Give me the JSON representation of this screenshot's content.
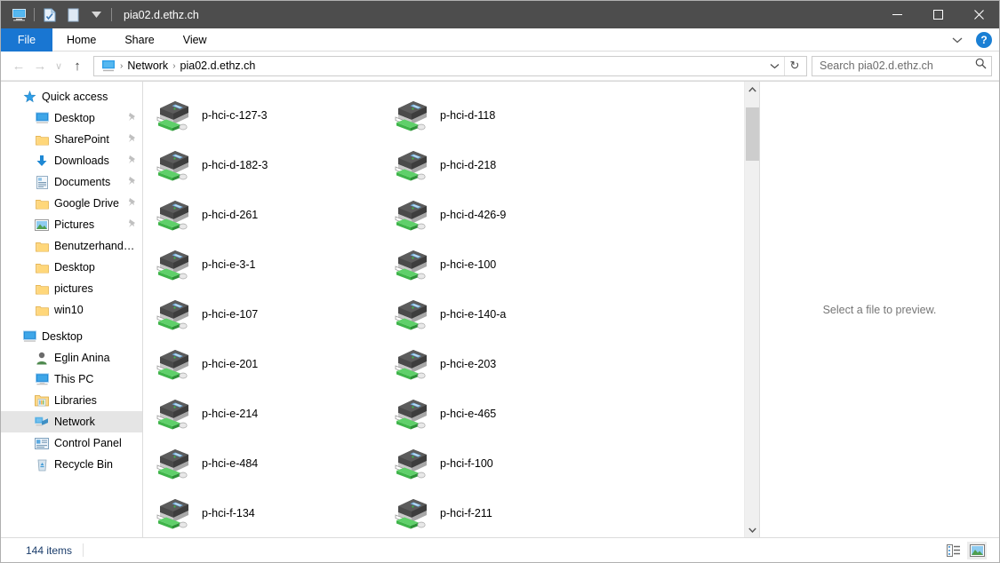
{
  "window": {
    "title": "pia02.d.ethz.ch",
    "quick_access_toolbar": [
      {
        "name": "this-pc-icon",
        "label": "This PC"
      },
      {
        "name": "properties-icon",
        "label": "Properties"
      },
      {
        "name": "new-folder-icon",
        "label": "New folder"
      },
      {
        "name": "customize-qat-dropdown",
        "label": "Customize Quick Access Toolbar"
      }
    ],
    "controls": {
      "minimize": "–",
      "maximize": "□",
      "close": "✕"
    }
  },
  "ribbon": {
    "tabs": [
      {
        "label": "File",
        "active": true
      },
      {
        "label": "Home",
        "active": false
      },
      {
        "label": "Share",
        "active": false
      },
      {
        "label": "View",
        "active": false
      }
    ],
    "collapse_label": "∨",
    "help_label": "?"
  },
  "addressbar": {
    "back_label": "←",
    "forward_label": "→",
    "recent_label": "∨",
    "up_label": "↑",
    "breadcrumbs": [
      "Network",
      "pia02.d.ethz.ch"
    ],
    "separator": "›",
    "dropdown_label": "∨",
    "refresh_label": "↻"
  },
  "search": {
    "placeholder": "Search pia02.d.ethz.ch",
    "value": "",
    "icon": "search-icon"
  },
  "sidebar": {
    "groups": [
      {
        "name": "quick-access",
        "header": {
          "label": "Quick access",
          "icon": "star-pin-icon",
          "level": 0
        },
        "items": [
          {
            "label": "Desktop",
            "icon": "desktop-icon",
            "pinned": true
          },
          {
            "label": "SharePoint",
            "icon": "folder-icon",
            "pinned": true
          },
          {
            "label": "Downloads",
            "icon": "download-icon",
            "pinned": true
          },
          {
            "label": "Documents",
            "icon": "documents-icon",
            "pinned": true
          },
          {
            "label": "Google Drive",
            "icon": "folder-icon",
            "pinned": true
          },
          {
            "label": "Pictures",
            "icon": "pictures-icon",
            "pinned": true
          },
          {
            "label": "Benutzerhandbuch",
            "icon": "folder-icon",
            "pinned": false
          },
          {
            "label": "Desktop",
            "icon": "folder-icon",
            "pinned": false
          },
          {
            "label": "pictures",
            "icon": "folder-icon",
            "pinned": false
          },
          {
            "label": "win10",
            "icon": "folder-icon",
            "pinned": false
          }
        ]
      },
      {
        "name": "tree-roots",
        "header": null,
        "items": [
          {
            "label": "Desktop",
            "icon": "desktop-icon",
            "pinned": false,
            "level": 0
          },
          {
            "label": "Eglin  Anina",
            "icon": "user-icon",
            "pinned": false,
            "level": 0
          },
          {
            "label": "This PC",
            "icon": "this-pc-icon",
            "pinned": false,
            "level": 0
          },
          {
            "label": "Libraries",
            "icon": "libraries-icon",
            "pinned": false,
            "level": 0
          },
          {
            "label": "Network",
            "icon": "network-icon",
            "pinned": false,
            "level": 0,
            "selected": true
          },
          {
            "label": "Control Panel",
            "icon": "control-panel-icon",
            "pinned": false,
            "level": 0
          },
          {
            "label": "Recycle Bin",
            "icon": "recycle-bin-icon",
            "pinned": false,
            "level": 0
          }
        ]
      }
    ]
  },
  "files": {
    "icon": "printer-icon",
    "columns": 2,
    "rows": [
      [
        "p-hci-c-127-3",
        "p-hci-d-118"
      ],
      [
        "p-hci-d-182-3",
        "p-hci-d-218"
      ],
      [
        "p-hci-d-261",
        "p-hci-d-426-9"
      ],
      [
        "p-hci-e-3-1",
        "p-hci-e-100"
      ],
      [
        "p-hci-e-107",
        "p-hci-e-140-a"
      ],
      [
        "p-hci-e-201",
        "p-hci-e-203"
      ],
      [
        "p-hci-e-214",
        "p-hci-e-465"
      ],
      [
        "p-hci-e-484",
        "p-hci-f-100"
      ],
      [
        "p-hci-f-134",
        "p-hci-f-211"
      ]
    ]
  },
  "scrollbar": {
    "up_label": "∧",
    "down_label": "∨"
  },
  "preview": {
    "message": "Select a file to preview."
  },
  "statusbar": {
    "item_count": "144 items",
    "views": [
      {
        "name": "details-view-button",
        "label": "Details view",
        "active": false
      },
      {
        "name": "large-icons-view-button",
        "label": "Large icons view",
        "active": true
      }
    ]
  },
  "colors": {
    "titlebar": "#4d4d4d",
    "file_tab": "#1976d2",
    "selection": "#e5e5e5",
    "accent": "#0078d7",
    "status_text": "#1b3d6b"
  }
}
